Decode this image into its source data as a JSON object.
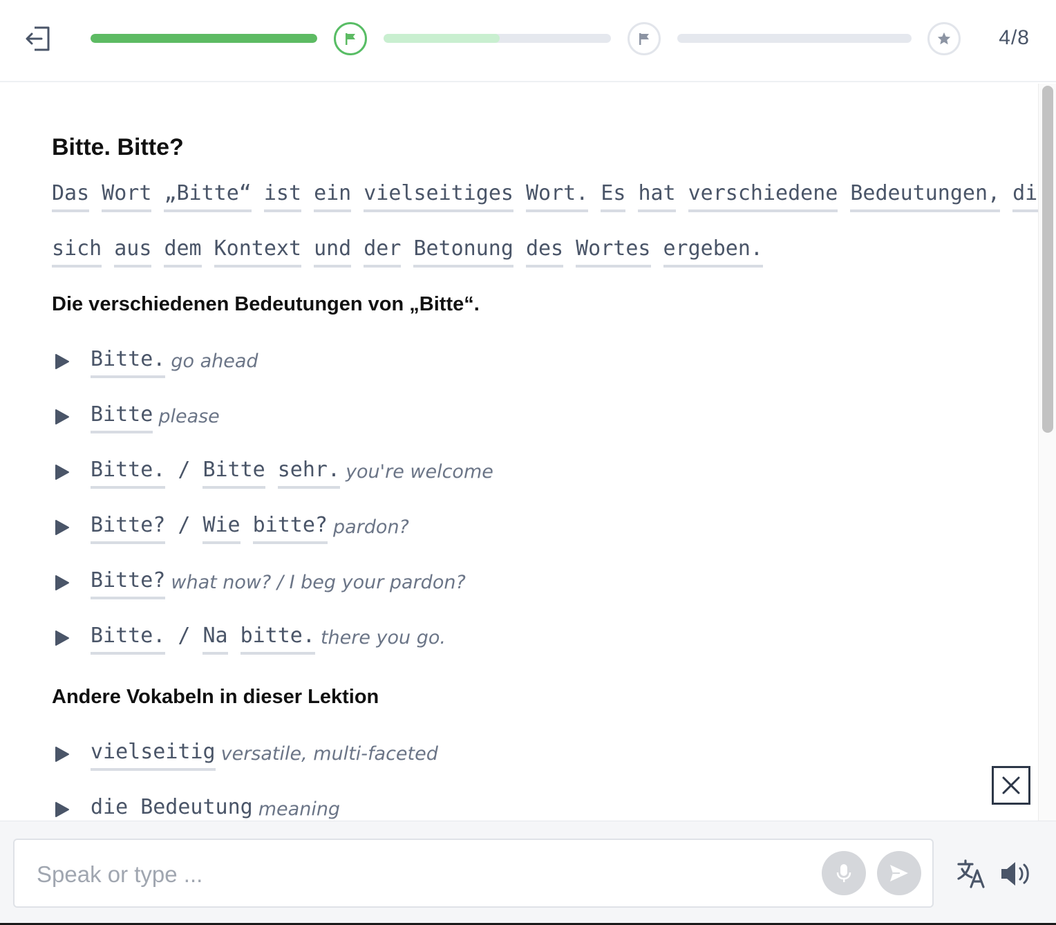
{
  "header": {
    "progress": [
      {
        "fraction": 1.0,
        "color": "#5dbb63"
      },
      {
        "fraction": 0.51,
        "color": "#c9efd0"
      },
      {
        "fraction": 0.0,
        "color": "#5dbb63"
      }
    ],
    "milestones": [
      "flag-icon",
      "flag-icon",
      "star-icon"
    ],
    "counter": "4/8"
  },
  "lesson": {
    "title": "Bitte. Bitte?",
    "paragraph_line1": [
      "Das",
      "Wort",
      "„Bitte“",
      "ist",
      "ein",
      "vielseitiges",
      "Wort.",
      "Es",
      "hat",
      "verschiedene",
      "Bedeutungen,",
      "die"
    ],
    "paragraph_line2": [
      "sich",
      "aus",
      "dem",
      "Kontext",
      "und",
      "der",
      "Betonung",
      "des",
      "Wortes",
      "ergeben."
    ],
    "meanings_heading": "Die verschiedenen Bedeutungen von „Bitte“.",
    "meanings": [
      {
        "words": [
          "Bitte."
        ],
        "translation": "go ahead"
      },
      {
        "words": [
          "Bitte"
        ],
        "translation": "please"
      },
      {
        "words": [
          "Bitte.",
          "/",
          "Bitte",
          "sehr."
        ],
        "translation": "you're welcome"
      },
      {
        "words": [
          "Bitte?",
          "/",
          "Wie",
          "bitte?"
        ],
        "translation": "pardon?"
      },
      {
        "words": [
          "Bitte?"
        ],
        "translation": "what now? / I beg your pardon?"
      },
      {
        "words": [
          "Bitte.",
          "/",
          "Na",
          "bitte."
        ],
        "translation": "there you go."
      }
    ],
    "vocab_heading": "Andere Vokabeln in dieser Lektion",
    "vocab": [
      {
        "words": [
          "vielseitig"
        ],
        "translation": "versatile, multi-faceted"
      },
      {
        "words": [
          "die",
          "Bedeutung"
        ],
        "translation": "meaning"
      }
    ]
  },
  "input": {
    "placeholder": "Speak or type ..."
  },
  "colors": {
    "accent_green": "#5dbb63",
    "text": "#4a5568"
  }
}
